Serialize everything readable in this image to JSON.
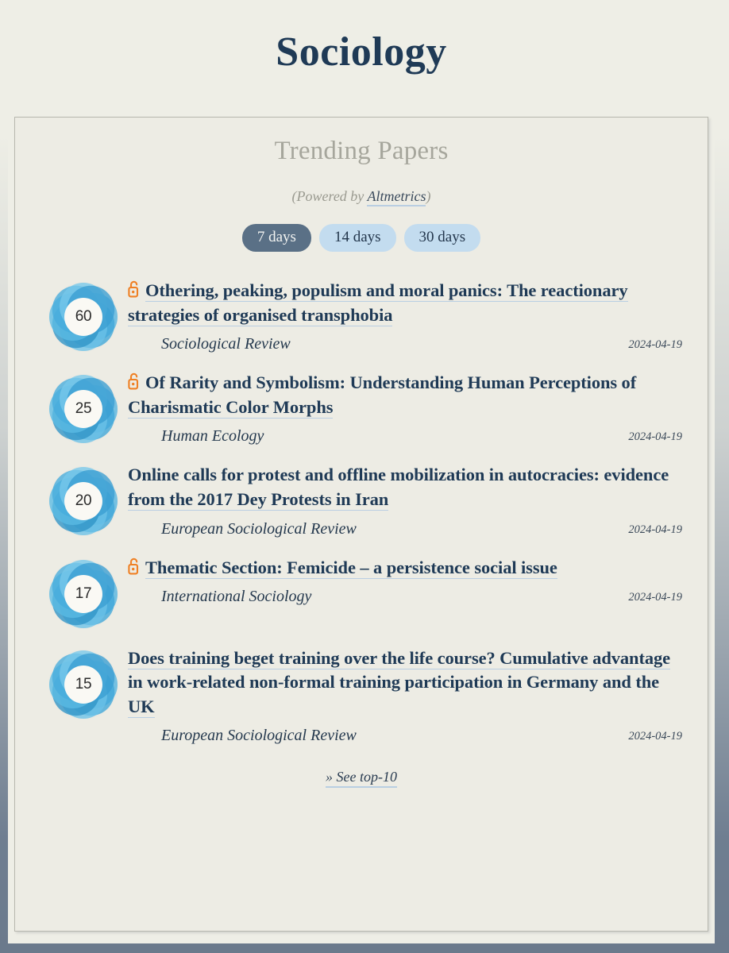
{
  "page": {
    "title": "Sociology"
  },
  "card": {
    "heading": "Trending Papers",
    "powered_prefix": "(Powered by ",
    "powered_link": "Altmetrics",
    "powered_suffix": ")"
  },
  "tabs": [
    {
      "label": "7 days",
      "active": true
    },
    {
      "label": "14 days",
      "active": false
    },
    {
      "label": "30 days",
      "active": false
    }
  ],
  "papers": [
    {
      "score": "60",
      "open_access": true,
      "open_access_icon": "open-lock-icon",
      "title": "Othering, peaking, populism and moral panics: The reactionary strategies of organised transphobia",
      "journal": "Sociological Review",
      "date": "2024-04-19"
    },
    {
      "score": "25",
      "open_access": true,
      "open_access_icon": "open-lock-icon",
      "title": "Of Rarity and Symbolism: Understanding Human Perceptions of Charismatic Color Morphs",
      "journal": "Human Ecology",
      "date": "2024-04-19"
    },
    {
      "score": "20",
      "open_access": false,
      "open_access_icon": "",
      "title": "Online calls for protest and offline mobilization in autocracies: evidence from the 2017 Dey Protests in Iran",
      "journal": "European Sociological Review",
      "date": "2024-04-19"
    },
    {
      "score": "17",
      "open_access": true,
      "open_access_icon": "open-lock-icon",
      "title": "Thematic Section: Femicide – a persistence social issue",
      "journal": "International Sociology",
      "date": "2024-04-19"
    },
    {
      "score": "15",
      "open_access": false,
      "open_access_icon": "",
      "title": "Does training beget training over the life course? Cumulative advantage in work-related non-formal training participation in Germany and the UK",
      "journal": "European Sociological Review",
      "date": "2024-04-19"
    }
  ],
  "footer": {
    "see_more": "» See top-10"
  },
  "colors": {
    "page_background": "#eeeee6",
    "frame": "#6b7a8c",
    "title_navy": "#1f3a56",
    "heading_gray": "#a6a69c",
    "tab_active_bg": "#5a7086",
    "tab_inactive_bg": "#c3dcef",
    "link_underline": "#b9cee2",
    "open_access_orange": "#ef8024",
    "badge_blue": "#3fa9dd",
    "badge_blue_dark": "#2b88bb"
  }
}
